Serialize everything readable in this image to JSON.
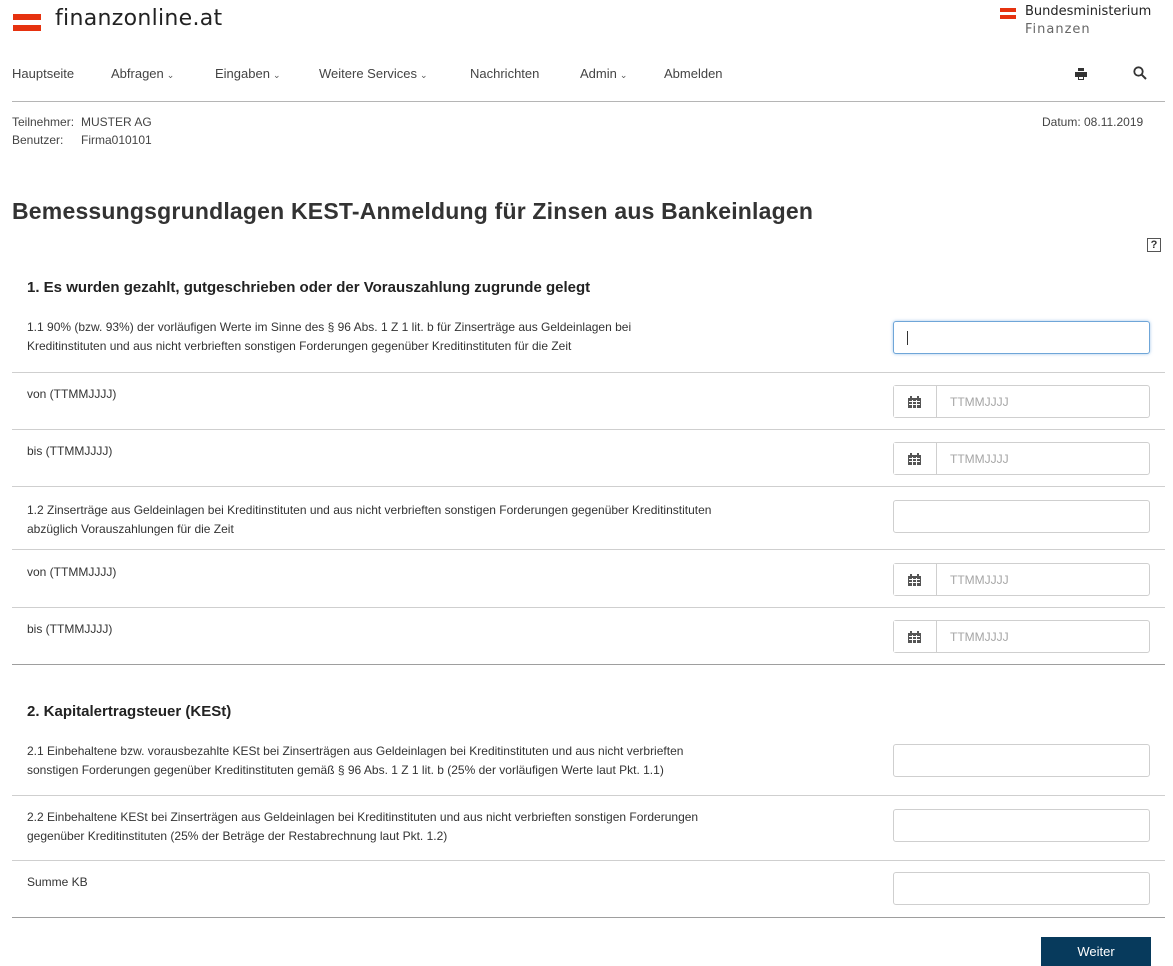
{
  "header": {
    "brand": "finanzonline.at",
    "ministry_line1": "Bundesministerium",
    "ministry_line2": "Finanzen"
  },
  "colors": {
    "brand_red": "#e6320f",
    "button_blue": "#073a5c"
  },
  "nav": {
    "items": [
      {
        "label": "Hauptseite",
        "dropdown": false
      },
      {
        "label": "Abfragen",
        "dropdown": true
      },
      {
        "label": "Eingaben",
        "dropdown": true
      },
      {
        "label": "Weitere Services",
        "dropdown": true
      },
      {
        "label": "Nachrichten",
        "dropdown": false
      },
      {
        "label": "Admin",
        "dropdown": true
      },
      {
        "label": "Abmelden",
        "dropdown": false
      }
    ],
    "print_icon": "print-icon",
    "search_icon": "search-icon"
  },
  "session": {
    "participant_label": "Teilnehmer:",
    "participant_value": "MUSTER AG",
    "user_label": "Benutzer:",
    "user_value": "Firma010101",
    "date_text": "Datum: 08.11.2019"
  },
  "page": {
    "title": "Bemessungsgrundlagen KEST-Anmeldung für Zinsen aus Bankeinlagen",
    "help_label": "?"
  },
  "section1": {
    "title": "1. Es wurden gezahlt, gutgeschrieben oder der Vorauszahlung zugrunde gelegt",
    "row_1_1_line1": "1.1 90% (bzw. 93%) der vorläufigen Werte im Sinne des § 96 Abs. 1 Z 1 lit. b für Zinserträge aus Geldeinlagen bei",
    "row_1_1_line2": "Kreditinstituten und aus nicht verbrieften sonstigen Forderungen gegenüber Kreditinstituten für die Zeit",
    "von_label": "von (TTMMJJJJ)",
    "bis_label": "bis (TTMMJJJJ)",
    "row_1_2_line1": "1.2 Zinserträge aus Geldeinlagen bei Kreditinstituten und aus nicht verbrieften sonstigen Forderungen gegenüber Kreditinstituten",
    "row_1_2_line2": "abzüglich Vorauszahlungen für die Zeit",
    "date_placeholder": "TTMMJJJJ"
  },
  "section2": {
    "title": "2. Kapitalertragsteuer (KESt)",
    "row_2_1_line1": "2.1 Einbehaltene bzw. vorausbezahlte KESt bei Zinserträgen aus Geldeinlagen bei Kreditinstituten und aus nicht verbrieften",
    "row_2_1_line2": "sonstigen Forderungen gegenüber Kreditinstituten gemäß § 96 Abs. 1 Z 1 lit. b (25% der vorläufigen Werte laut Pkt. 1.1)",
    "row_2_2_line1": "2.2 Einbehaltene KESt bei Zinserträgen aus Geldeinlagen bei Kreditinstituten und aus nicht verbrieften sonstigen Forderungen",
    "row_2_2_line2": "gegenüber Kreditinstituten (25% der Beträge der Restabrechnung laut Pkt. 1.2)",
    "summe_label": "Summe KB"
  },
  "actions": {
    "next_label": "Weiter"
  }
}
